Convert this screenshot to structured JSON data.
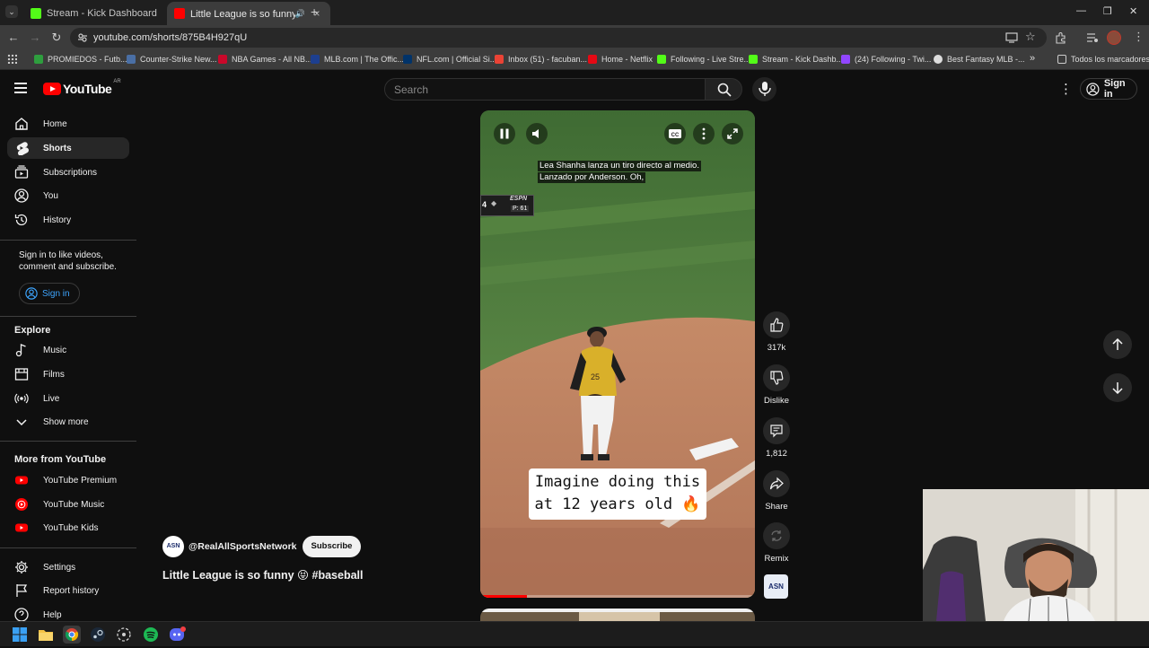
{
  "browser": {
    "tabs": [
      {
        "title": "Stream - Kick Dashboard",
        "active": false,
        "favicon_color": "#53fc18"
      },
      {
        "title": "Little League is so funny 😝",
        "active": true,
        "favicon_color": "#ff0000"
      }
    ],
    "new_tab_label": "+",
    "url": "youtube.com/shorts/875B4H927qU",
    "bookmarks": [
      {
        "label": "PROMIEDOS - Futb...",
        "color": "#2e9e3e"
      },
      {
        "label": "Counter-Strike New...",
        "color": "#4a6fa5"
      },
      {
        "label": "NBA Games - All NB...",
        "color": "#c9082a"
      },
      {
        "label": "MLB.com | The Offic...",
        "color": "#1d3f8f"
      },
      {
        "label": "NFL.com | Official Si...",
        "color": "#013369"
      },
      {
        "label": "Inbox (51) - facuban...",
        "color": "#ea4335"
      },
      {
        "label": "Home - Netflix",
        "color": "#e50914"
      },
      {
        "label": "Following - Live Stre...",
        "color": "#53fc18"
      },
      {
        "label": "Stream - Kick Dashb...",
        "color": "#53fc18"
      },
      {
        "label": "(24) Following - Twi...",
        "color": "#9146ff"
      },
      {
        "label": "Best Fantasy MLB -...",
        "color": "#dddddd"
      }
    ],
    "bookmarks_more": "»",
    "all_bookmarks": "Todos los marcadores"
  },
  "youtube": {
    "logo_text": "YouTube",
    "country_code": "AR",
    "search_placeholder": "Search",
    "signin_label": "Sign in",
    "sidebar": {
      "main": [
        {
          "label": "Home",
          "icon": "home-icon"
        },
        {
          "label": "Shorts",
          "icon": "shorts-icon",
          "active": true
        },
        {
          "label": "Subscriptions",
          "icon": "subscriptions-icon"
        },
        {
          "label": "You",
          "icon": "you-icon"
        },
        {
          "label": "History",
          "icon": "history-icon"
        }
      ],
      "signin_prompt": "Sign in to like videos, comment and subscribe.",
      "signin_button": "Sign in",
      "explore_header": "Explore",
      "explore": [
        {
          "label": "Music",
          "icon": "music-icon"
        },
        {
          "label": "Films",
          "icon": "films-icon"
        },
        {
          "label": "Live",
          "icon": "live-icon"
        },
        {
          "label": "Show more",
          "icon": "chevron-down-icon"
        }
      ],
      "more_header": "More from YouTube",
      "more": [
        {
          "label": "YouTube Premium",
          "icon": "youtube-premium-icon"
        },
        {
          "label": "YouTube Music",
          "icon": "youtube-music-icon"
        },
        {
          "label": "YouTube Kids",
          "icon": "youtube-kids-icon"
        }
      ],
      "footer": [
        {
          "label": "Settings",
          "icon": "gear-icon"
        },
        {
          "label": "Report history",
          "icon": "flag-icon"
        },
        {
          "label": "Help",
          "icon": "help-icon"
        }
      ]
    },
    "short": {
      "captions": [
        "Lea Shanha lanza un tiro directo al medio.",
        "Lanzado por Anderson.  Oh,"
      ],
      "scorebug": {
        "network": "ESPN",
        "inning": "4",
        "pitch_count": "P: 61"
      },
      "overlay_caption_line1": "Imagine doing this",
      "overlay_caption_line2": "at 12 years old 🔥",
      "progress": 0.17,
      "channel_avatar_text": "ASN",
      "channel_handle": "@RealAllSportsNetwork",
      "subscribe_label": "Subscribe",
      "title": "Little League is so funny 😝 #baseball"
    },
    "actions": {
      "likes": "317k",
      "dislike": "Dislike",
      "comments": "1,812",
      "share": "Share",
      "remix": "Remix"
    }
  }
}
